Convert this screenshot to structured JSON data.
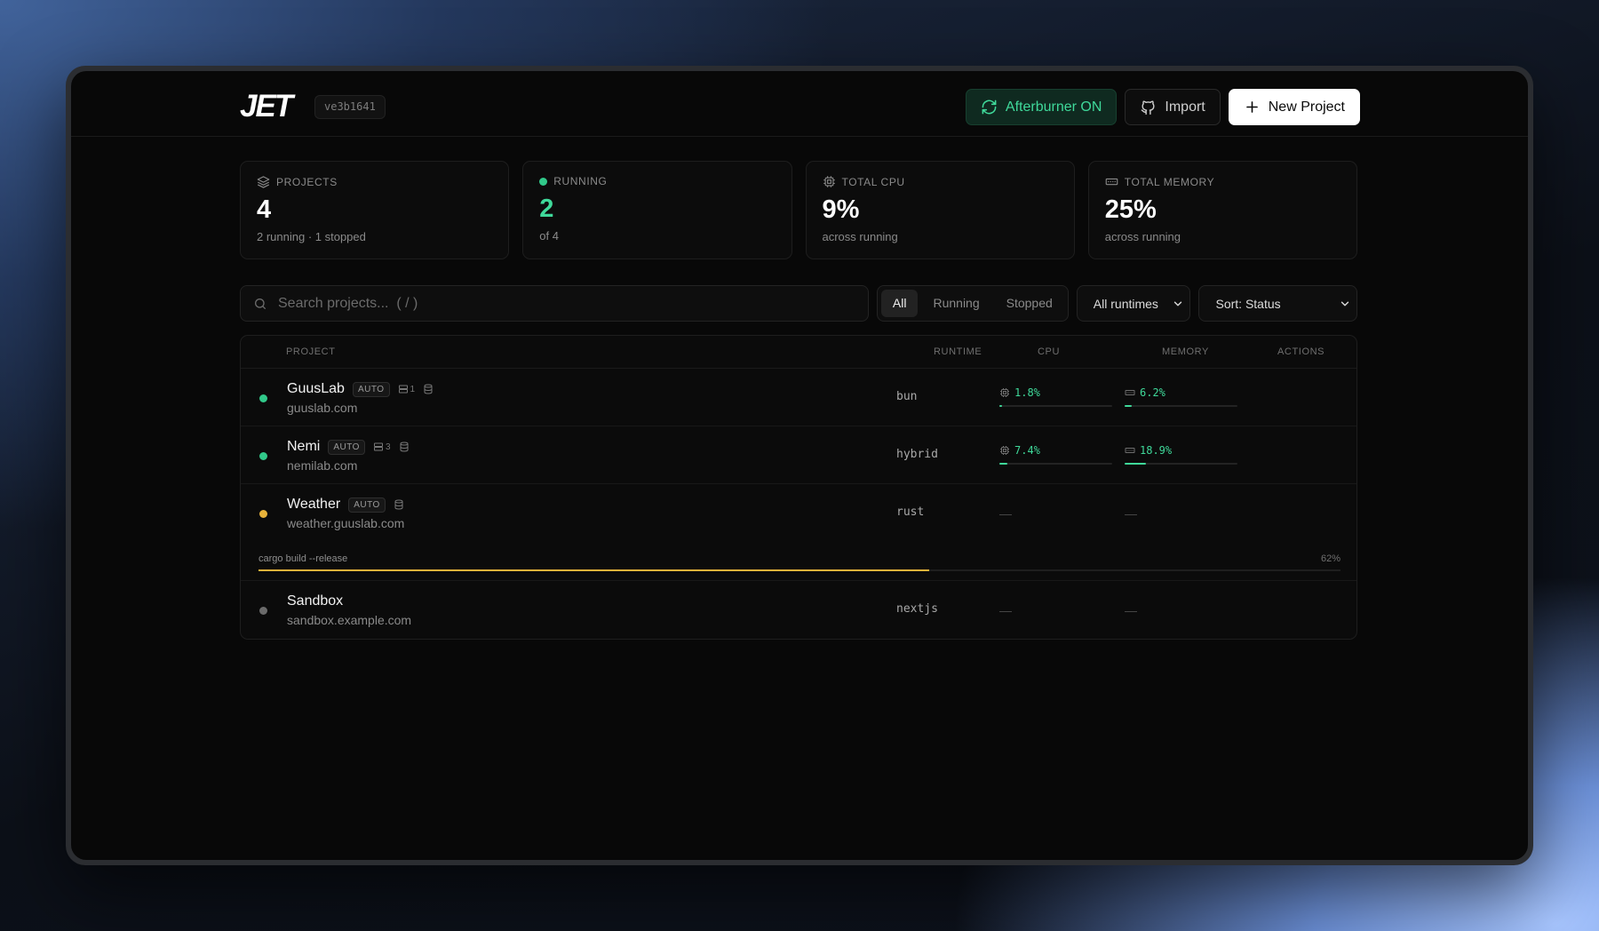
{
  "header": {
    "logo": "JET",
    "version": "ve3b1641",
    "afterburner_label": "Afterburner ON",
    "import_label": "Import",
    "new_project_label": "New Project"
  },
  "stats": [
    {
      "label": "PROJECTS",
      "value": "4",
      "sub": "2 running · 1 stopped",
      "icon": "layers-icon"
    },
    {
      "label": "RUNNING",
      "value": "2",
      "sub": "of 4",
      "icon": "status-dot"
    },
    {
      "label": "TOTAL CPU",
      "value": "9%",
      "sub": "across running",
      "icon": "cpu-icon"
    },
    {
      "label": "TOTAL MEMORY",
      "value": "25%",
      "sub": "across running",
      "icon": "memory-icon"
    }
  ],
  "toolbar": {
    "search_placeholder": "Search projects...  ( / )",
    "filters": [
      "All",
      "Running",
      "Stopped"
    ],
    "active_filter": "All",
    "runtime_select": "All runtimes",
    "sort_select": "Sort: Status"
  },
  "table": {
    "columns": {
      "project": "PROJECT",
      "runtime": "RUNTIME",
      "cpu": "CPU",
      "memory": "MEMORY",
      "actions": "ACTIONS"
    },
    "rows": [
      {
        "name": "GuusLab",
        "badge": "AUTO",
        "count": "1",
        "domain": "guuslab.com",
        "runtime": "bun",
        "cpu": "1.8%",
        "cpu_pct": 1.8,
        "memory": "6.2%",
        "memory_pct": 6.2,
        "status_color": "#31c98a"
      },
      {
        "name": "Nemi",
        "badge": "AUTO",
        "count": "3",
        "domain": "nemilab.com",
        "runtime": "hybrid",
        "cpu": "7.4%",
        "cpu_pct": 7.4,
        "memory": "18.9%",
        "memory_pct": 18.9,
        "status_color": "#31c98a"
      },
      {
        "name": "Weather",
        "badge": "AUTO",
        "domain": "weather.guuslab.com",
        "runtime": "rust",
        "cpu": "—",
        "memory": "—",
        "status_color": "#e8b33a",
        "build_cmd": "cargo build --release",
        "build_progress": "62%",
        "build_pct": 62
      },
      {
        "name": "Sandbox",
        "domain": "sandbox.example.com",
        "runtime": "nextjs",
        "cpu": "—",
        "memory": "—",
        "status_color": "#6b6b6b"
      }
    ]
  },
  "colors": {
    "accent_green": "#3fd99a",
    "build_amber": "#e8b33a",
    "background": "#080808"
  }
}
